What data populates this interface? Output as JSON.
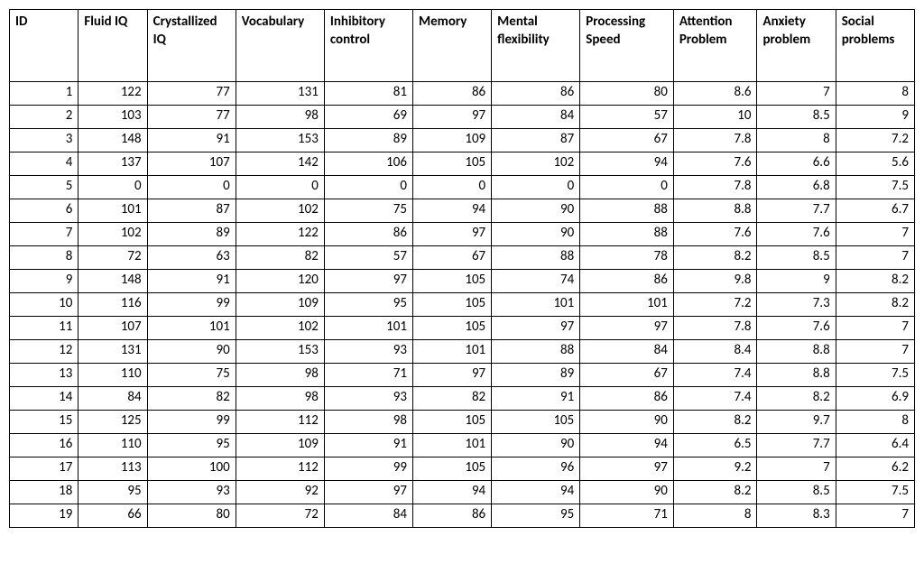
{
  "chart_data": {
    "type": "table",
    "columns": [
      "ID",
      "Fluid IQ",
      "Crystallized IQ",
      "Vocabulary",
      "Inhibitory control",
      "Memory",
      "Mental flexibility",
      "Processing Speed",
      "Attention Problem",
      "Anxiety problem",
      "Social problems"
    ],
    "rows": [
      [
        1,
        122,
        77,
        131,
        81,
        86,
        86,
        80,
        8.6,
        7,
        8
      ],
      [
        2,
        103,
        77,
        98,
        69,
        97,
        84,
        57,
        10,
        8.5,
        9
      ],
      [
        3,
        148,
        91,
        153,
        89,
        109,
        87,
        67,
        7.8,
        8,
        7.2
      ],
      [
        4,
        137,
        107,
        142,
        106,
        105,
        102,
        94,
        7.6,
        6.6,
        5.6
      ],
      [
        5,
        0,
        0,
        0,
        0,
        0,
        0,
        0,
        7.8,
        6.8,
        7.5
      ],
      [
        6,
        101,
        87,
        102,
        75,
        94,
        90,
        88,
        8.8,
        7.7,
        6.7
      ],
      [
        7,
        102,
        89,
        122,
        86,
        97,
        90,
        88,
        7.6,
        7.6,
        7
      ],
      [
        8,
        72,
        63,
        82,
        57,
        67,
        88,
        78,
        8.2,
        8.5,
        7
      ],
      [
        9,
        148,
        91,
        120,
        97,
        105,
        74,
        86,
        9.8,
        9,
        8.2
      ],
      [
        10,
        116,
        99,
        109,
        95,
        105,
        101,
        101,
        7.2,
        7.3,
        8.2
      ],
      [
        11,
        107,
        101,
        102,
        101,
        105,
        97,
        97,
        7.8,
        7.6,
        7
      ],
      [
        12,
        131,
        90,
        153,
        93,
        101,
        88,
        84,
        8.4,
        8.8,
        7
      ],
      [
        13,
        110,
        75,
        98,
        71,
        97,
        89,
        67,
        7.4,
        8.8,
        7.5
      ],
      [
        14,
        84,
        82,
        98,
        93,
        82,
        91,
        86,
        7.4,
        8.2,
        6.9
      ],
      [
        15,
        125,
        99,
        112,
        98,
        105,
        105,
        90,
        8.2,
        9.7,
        8
      ],
      [
        16,
        110,
        95,
        109,
        91,
        101,
        90,
        94,
        6.5,
        7.7,
        6.4
      ],
      [
        17,
        113,
        100,
        112,
        99,
        105,
        96,
        97,
        9.2,
        7,
        6.2
      ],
      [
        18,
        95,
        93,
        92,
        97,
        94,
        94,
        90,
        8.2,
        8.5,
        7.5
      ],
      [
        19,
        66,
        80,
        72,
        84,
        86,
        95,
        71,
        8,
        8.3,
        7
      ]
    ]
  },
  "headers_display": {
    "c0": "ID",
    "c1": "Fluid IQ",
    "c2": "Crystallized IQ",
    "c3": "Vocabulary",
    "c4": "Inhibitory control",
    "c5": "Memory",
    "c6": "Mental flexibility",
    "c7": "Processing Speed",
    "c8": "Attention Problem",
    "c9": "Anxiety problem",
    "c10": "Social problems"
  }
}
